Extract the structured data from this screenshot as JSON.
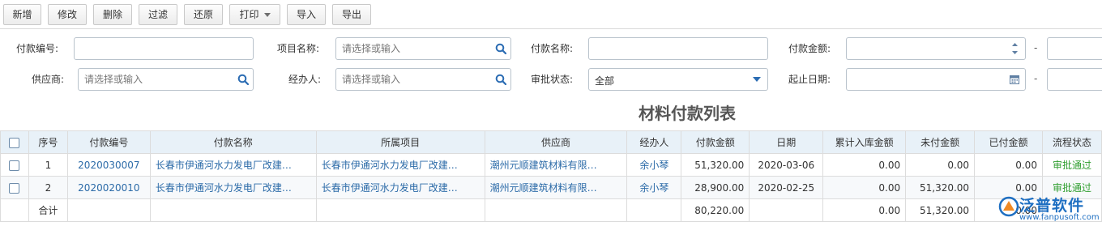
{
  "toolbar": {
    "add": "新增",
    "edit": "修改",
    "delete": "删除",
    "filter": "过滤",
    "restore": "还原",
    "print": "打印",
    "import": "导入",
    "export": "导出"
  },
  "filters": {
    "pay_no_label": "付款编号:",
    "pay_no_value": "",
    "project_label": "项目名称:",
    "project_placeholder": "请选择或输入",
    "pay_name_label": "付款名称:",
    "pay_name_value": "",
    "amount_label": "付款金额:",
    "amount_value": "",
    "supplier_label": "供应商:",
    "supplier_placeholder": "请选择或输入",
    "handler_label": "经办人:",
    "handler_placeholder": "请选择或输入",
    "status_label": "审批状态:",
    "status_value": "全部",
    "date_label": "起止日期:",
    "dash": "-"
  },
  "page_title": "材料付款列表",
  "table": {
    "columns": [
      "序号",
      "付款编号",
      "付款名称",
      "所属项目",
      "供应商",
      "经办人",
      "付款金额",
      "日期",
      "累计入库金额",
      "未付金额",
      "已付金额",
      "流程状态"
    ],
    "rows": [
      {
        "no": "1",
        "pay_no": "2020030007",
        "pay_name": "长春市伊通河水力发电厂改建…",
        "project": "长春市伊通河水力发电厂改建…",
        "supplier": "潮州元顺建筑材料有限…",
        "handler": "余小琴",
        "amount": "51,320.00",
        "date": "2020-03-06",
        "stock_total": "0.00",
        "unpaid": "0.00",
        "paid": "0.00",
        "status": "审批通过"
      },
      {
        "no": "2",
        "pay_no": "2020020010",
        "pay_name": "长春市伊通河水力发电厂改建…",
        "project": "长春市伊通河水力发电厂改建…",
        "supplier": "潮州元顺建筑材料有限…",
        "handler": "余小琴",
        "amount": "28,900.00",
        "date": "2020-02-25",
        "stock_total": "0.00",
        "unpaid": "51,320.00",
        "paid": "0.00",
        "status": "审批通过"
      }
    ],
    "summary": {
      "label": "合计",
      "amount": "80,220.00",
      "stock_total": "0.00",
      "unpaid": "51,320.00",
      "paid": "0.00"
    }
  },
  "watermark": {
    "brand": "泛普软件",
    "url": "www.fanpusoft.com"
  },
  "colors": {
    "link": "#2c6ba8",
    "status_ok": "#2f9e2f",
    "header_bg": "#e8f1f8",
    "brand": "#1e6fc2"
  },
  "icons": [
    "search-icon",
    "spinner-arrows-icon",
    "dropdown-caret-icon",
    "calendar-icon",
    "checkbox-icon",
    "logo-icon"
  ]
}
